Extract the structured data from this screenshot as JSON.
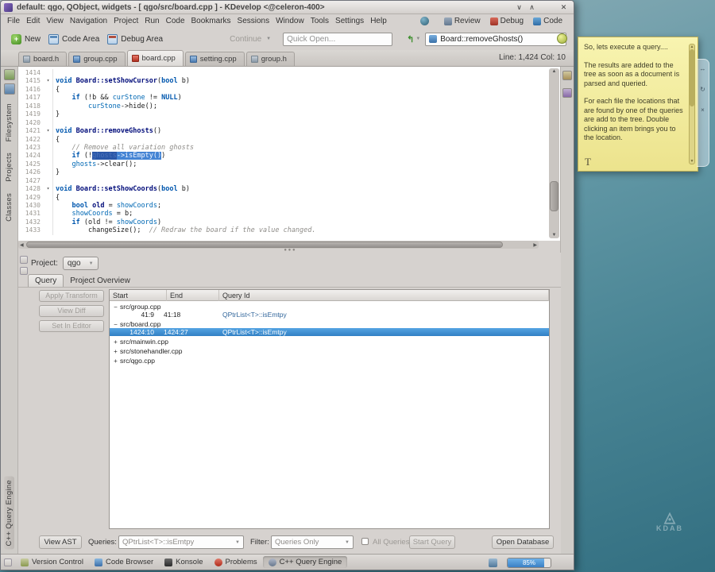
{
  "window": {
    "title": "default:  qgo, QObject, widgets - [ qgo/src/board.cpp ] - KDevelop <@celeron-400>"
  },
  "menubar": {
    "items": [
      "File",
      "Edit",
      "View",
      "Navigation",
      "Project",
      "Run",
      "Code",
      "Bookmarks",
      "Sessions",
      "Window",
      "Tools",
      "Settings",
      "Help"
    ],
    "area_buttons": [
      {
        "id": "review",
        "label": "Review"
      },
      {
        "id": "debug",
        "label": "Debug"
      },
      {
        "id": "code",
        "label": "Code"
      }
    ]
  },
  "toolbar": {
    "new_label": "New",
    "code_area_label": "Code Area",
    "debug_area_label": "Debug Area",
    "continue_label": "Continue",
    "quick_open_placeholder": "Quick Open...",
    "symbol_combo": "Board::removeGhosts()"
  },
  "tabbar": {
    "tabs": [
      {
        "label": "board.h",
        "icon": "header-file-icon",
        "active": false,
        "modified": false
      },
      {
        "label": "group.cpp",
        "icon": "cpp-file-icon",
        "active": false,
        "modified": false
      },
      {
        "label": "board.cpp",
        "icon": "modified-file-icon",
        "active": true,
        "modified": true
      },
      {
        "label": "setting.cpp",
        "icon": "cpp-file-icon",
        "active": false,
        "modified": false
      },
      {
        "label": "group.h",
        "icon": "header-file-icon",
        "active": false,
        "modified": false
      }
    ],
    "cursor_position": "Line: 1,424 Col: 10"
  },
  "left_dock": {
    "labels": [
      "Filesystem",
      "Projects",
      "Classes"
    ],
    "bottom_label": "C++ Query Engine"
  },
  "editor": {
    "lines": [
      {
        "num": 1414,
        "segs": []
      },
      {
        "num": 1415,
        "fold": true,
        "segs": [
          [
            "kw",
            "void"
          ],
          [
            "pl",
            " "
          ],
          [
            "fn",
            "Board::setShowCursor"
          ],
          [
            "pl",
            "("
          ],
          [
            "kw",
            "bool"
          ],
          [
            "pl",
            " b)"
          ]
        ]
      },
      {
        "num": 1416,
        "segs": [
          [
            "pl",
            "{"
          ]
        ]
      },
      {
        "num": 1417,
        "segs": [
          [
            "pl",
            "    "
          ],
          [
            "kw",
            "if"
          ],
          [
            "pl",
            " (!b && "
          ],
          [
            "mem",
            "curStone"
          ],
          [
            "pl",
            " != "
          ],
          [
            "kw",
            "NULL"
          ],
          [
            "pl",
            ")"
          ]
        ]
      },
      {
        "num": 1418,
        "segs": [
          [
            "pl",
            "        "
          ],
          [
            "mem",
            "curStone"
          ],
          [
            "pl",
            "->hide();"
          ]
        ]
      },
      {
        "num": 1419,
        "segs": [
          [
            "pl",
            "}"
          ]
        ]
      },
      {
        "num": 1420,
        "segs": []
      },
      {
        "num": 1421,
        "fold": true,
        "segs": [
          [
            "kw",
            "void"
          ],
          [
            "pl",
            " "
          ],
          [
            "fn",
            "Board::removeGhosts"
          ],
          [
            "pl",
            "()"
          ]
        ]
      },
      {
        "num": 1422,
        "segs": [
          [
            "pl",
            "{"
          ]
        ]
      },
      {
        "num": 1423,
        "segs": [
          [
            "cm",
            "    // Remove all variation ghosts"
          ]
        ]
      },
      {
        "num": 1424,
        "segs": [
          [
            "pl",
            "    "
          ],
          [
            "kw",
            "if"
          ],
          [
            "pl",
            " (!"
          ],
          [
            "m1",
            "ghosts"
          ],
          [
            "m2",
            "->isEmpty()"
          ],
          [
            "pl",
            ")"
          ]
        ]
      },
      {
        "num": 1425,
        "segs": [
          [
            "pl",
            "    "
          ],
          [
            "mem",
            "ghosts"
          ],
          [
            "pl",
            "->clear();"
          ]
        ]
      },
      {
        "num": 1426,
        "segs": [
          [
            "pl",
            "}"
          ]
        ]
      },
      {
        "num": 1427,
        "segs": []
      },
      {
        "num": 1428,
        "fold": true,
        "segs": [
          [
            "kw",
            "void"
          ],
          [
            "pl",
            " "
          ],
          [
            "fn",
            "Board::setShowCoords"
          ],
          [
            "pl",
            "("
          ],
          [
            "kw",
            "bool"
          ],
          [
            "pl",
            " b)"
          ]
        ]
      },
      {
        "num": 1429,
        "segs": [
          [
            "pl",
            "{"
          ]
        ]
      },
      {
        "num": 1430,
        "segs": [
          [
            "pl",
            "    "
          ],
          [
            "kw",
            "bool"
          ],
          [
            "pl",
            " "
          ],
          [
            "fn",
            "old"
          ],
          [
            "pl",
            " = "
          ],
          [
            "mem",
            "showCoords"
          ],
          [
            "pl",
            ";"
          ]
        ]
      },
      {
        "num": 1431,
        "segs": [
          [
            "pl",
            "    "
          ],
          [
            "mem",
            "showCoords"
          ],
          [
            "pl",
            " = b;"
          ]
        ]
      },
      {
        "num": 1432,
        "segs": [
          [
            "pl",
            "    "
          ],
          [
            "kw",
            "if"
          ],
          [
            "pl",
            " (old != "
          ],
          [
            "mem",
            "showCoords"
          ],
          [
            "pl",
            ")"
          ]
        ]
      },
      {
        "num": 1433,
        "segs": [
          [
            "pl",
            "        changeSize();"
          ],
          [
            "cm",
            "  // Redraw the board if the value changed."
          ]
        ]
      }
    ]
  },
  "query_panel": {
    "project_label": "Project:",
    "project_value": "qgo",
    "tabs": [
      {
        "label": "Query",
        "active": true
      },
      {
        "label": "Project Overview",
        "active": false
      }
    ],
    "action_buttons": [
      {
        "label": "Apply Transform",
        "enabled": false
      },
      {
        "label": "View Diff",
        "enabled": false
      },
      {
        "label": "Set In Editor",
        "enabled": false
      }
    ],
    "results_table": {
      "columns": [
        "Start",
        "End",
        "Query Id"
      ],
      "rows": [
        {
          "kind": "file",
          "expanded": true,
          "label": "src/group.cpp"
        },
        {
          "kind": "match",
          "start": "41:9",
          "end": "41:18",
          "query_id": "QPtrList<T>::isEmtpy",
          "selected": false
        },
        {
          "kind": "file",
          "expanded": true,
          "label": "src/board.cpp"
        },
        {
          "kind": "match",
          "start": "1424:10",
          "end": "1424:27",
          "query_id": "QPtrList<T>::isEmtpy",
          "selected": true
        },
        {
          "kind": "file",
          "expanded": false,
          "label": "src/mainwin.cpp"
        },
        {
          "kind": "file",
          "expanded": false,
          "label": "src/stonehandler.cpp"
        },
        {
          "kind": "file",
          "expanded": false,
          "label": "src/qgo.cpp"
        }
      ]
    },
    "footer": {
      "view_ast": "View AST",
      "queries_label": "Queries:",
      "queries_value": "QPtrList<T>::isEmtpy",
      "filter_label": "Filter:",
      "filter_value": "Queries Only",
      "all_queries_label": "All Queries",
      "start_query": "Start Query",
      "open_database": "Open Database"
    }
  },
  "statusbar": {
    "toolviews": [
      {
        "label": "Version Control",
        "icon": "version-control-icon",
        "active": false
      },
      {
        "label": "Code Browser",
        "icon": "code-browser-icon",
        "active": false
      },
      {
        "label": "Konsole",
        "icon": "konsole-icon",
        "active": false
      },
      {
        "label": "Problems",
        "icon": "problems-icon",
        "active": false
      },
      {
        "label": "C++ Query Engine",
        "icon": "query-engine-icon",
        "active": true
      }
    ],
    "progress_percent": 85,
    "progress_label": "85%"
  },
  "note": {
    "paragraphs": [
      "So, lets execute a query....",
      "The results are added to the tree as soon as a document is parsed and queried.",
      "For each file the locations that are found by one of the queries are add to the tree. Double clicking an item brings you to the location."
    ],
    "format_button": "T"
  },
  "desktop": {
    "watermark": "KDAB"
  }
}
